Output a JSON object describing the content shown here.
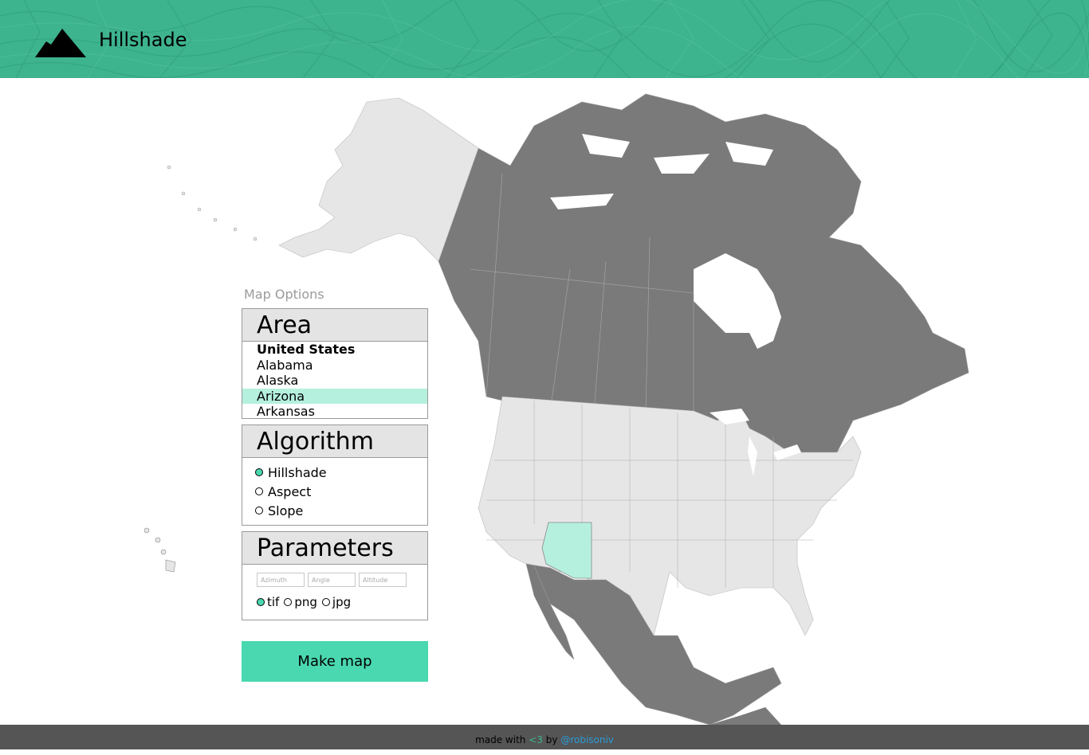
{
  "header": {
    "brand": "Hillshade",
    "logo_icon": "mountain-icon",
    "bg_color": "#3db38e"
  },
  "panel": {
    "caption": "Map Options",
    "area": {
      "title": "Area",
      "items": [
        "United States",
        "Alabama",
        "Alaska",
        "Arizona",
        "Arkansas"
      ],
      "selected": "Arizona"
    },
    "algorithm": {
      "title": "Algorithm",
      "options": [
        "Hillshade",
        "Aspect",
        "Slope"
      ],
      "selected": "Hillshade"
    },
    "parameters": {
      "title": "Parameters",
      "azimuth_placeholder": "Azimuth",
      "angle_placeholder": "Angle",
      "altitude_placeholder": "Altitude",
      "formats": [
        "tif",
        "png",
        "jpg"
      ],
      "selected_format": "tif"
    }
  },
  "make_button": "Make map",
  "map": {
    "highlight_color": "#b5f0de",
    "us_color": "#e6e6e6",
    "foreign_color": "#7a7a7a",
    "selected_state": "Arizona"
  },
  "footer": {
    "prefix": "made with",
    "heart": "<3",
    "by": "by",
    "handle": "@robisoniv",
    "bg_color": "#555555"
  }
}
